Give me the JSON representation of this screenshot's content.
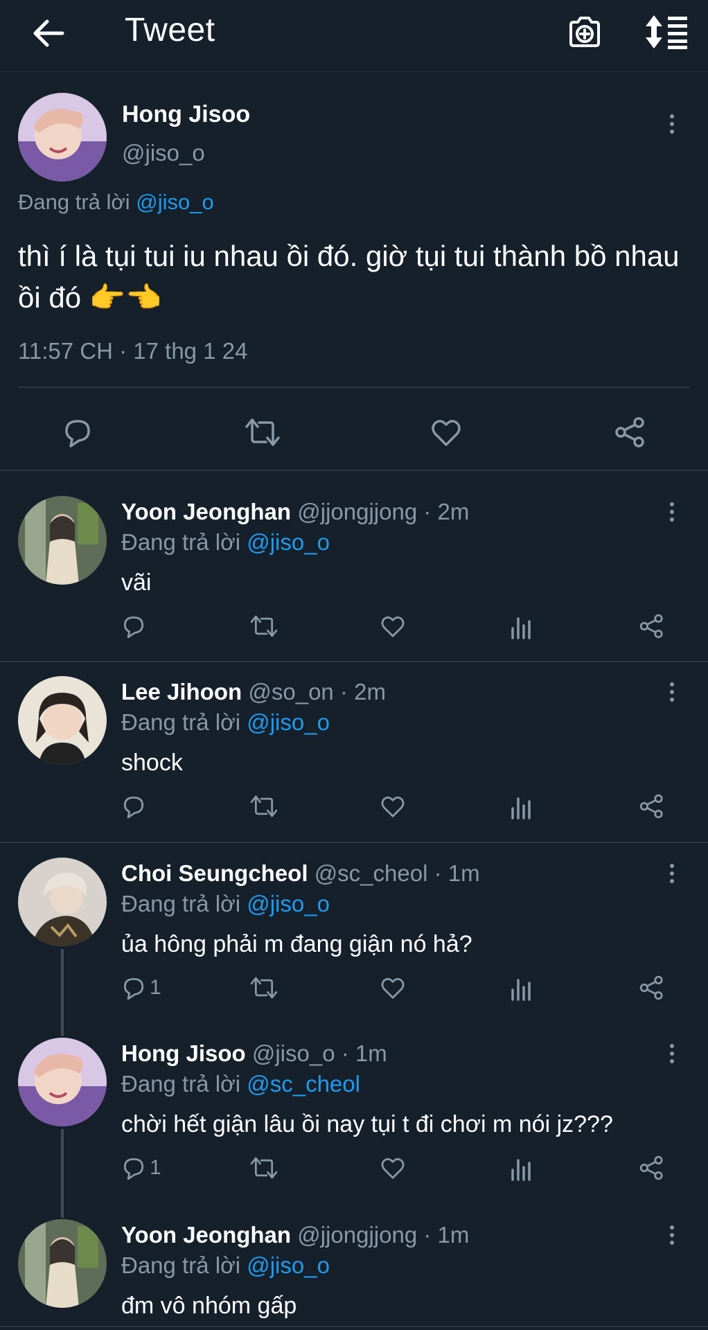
{
  "header": {
    "title": "Tweet",
    "back_icon": "arrow-left-icon",
    "camera_icon": "camera-plus-icon",
    "sort_icon": "sort-icon"
  },
  "main_tweet": {
    "name": "Hong Jisoo",
    "handle": "@jiso_o",
    "replying_label": "Đang trả lời",
    "replying_to": "@jiso_o",
    "text": "thì í là tụi tui iu nhau ồi đó. giờ tụi tui thành bồ nhau ồi đó 👉👈",
    "timestamp": "11:57 CH · 17 thg 1 24"
  },
  "replies": [
    {
      "name": "Yoon Jeonghan",
      "handle": "@jjongjjong",
      "time": "· 2m",
      "replying_label": "Đang trả lời",
      "replying_to": "@jiso_o",
      "text": "vãi",
      "reply_count": ""
    },
    {
      "name": "Lee Jihoon",
      "handle": "@so_on",
      "time": "· 2m",
      "replying_label": "Đang trả lời",
      "replying_to": "@jiso_o",
      "text": "shock",
      "reply_count": ""
    },
    {
      "name": "Choi Seungcheol",
      "handle": "@sc_cheol",
      "time": "· 1m",
      "replying_label": "Đang trả lời",
      "replying_to": "@jiso_o",
      "text": "ủa hông phải m đang giận nó hả?",
      "reply_count": "1"
    },
    {
      "name": "Hong Jisoo",
      "handle": "@jiso_o",
      "time": "· 1m",
      "replying_label": "Đang trả lời",
      "replying_to": "@sc_cheol",
      "text": "chời hết giận lâu ồi nay tụi t đi chơi m nói jz???",
      "reply_count": "1"
    },
    {
      "name": "Yoon Jeonghan",
      "handle": "@jjongjjong",
      "time": "· 1m",
      "replying_label": "Đang trả lời",
      "replying_to": "@jiso_o",
      "text": "đm vô nhóm gấp",
      "reply_count": ""
    }
  ],
  "colors": {
    "background": "#15202b",
    "accent": "#1d9bf0",
    "muted": "#8899a6",
    "divider": "#2a3642"
  }
}
